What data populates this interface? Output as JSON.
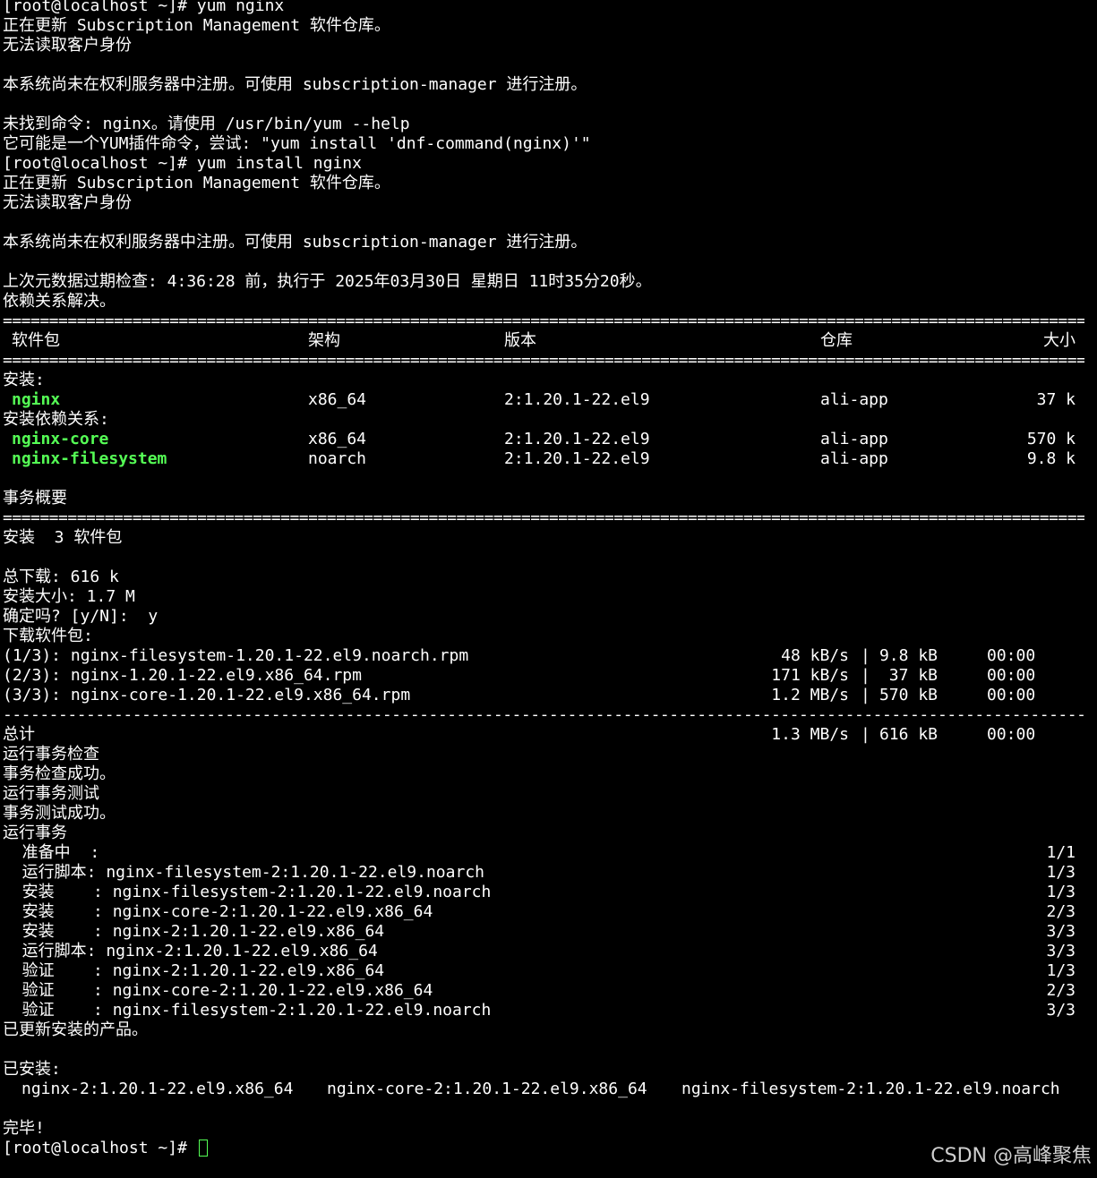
{
  "terminal": {
    "lines": [
      "[root@localhost ~]# yum nginx",
      "正在更新 Subscription Management 软件仓库。",
      "无法读取客户身份",
      "",
      "本系统尚未在权利服务器中注册。可使用 subscription-manager 进行注册。",
      "",
      "未找到命令: nginx。请使用 /usr/bin/yum --help",
      "它可能是一个YUM插件命令，尝试: \"yum install 'dnf-command(nginx)'\"",
      "[root@localhost ~]# yum install nginx",
      "正在更新 Subscription Management 软件仓库。",
      "无法读取客户身份",
      "",
      "本系统尚未在权利服务器中注册。可使用 subscription-manager 进行注册。",
      "",
      "上次元数据过期检查: 4:36:28 前，执行于 2025年03月30日 星期日 11时35分20秒。",
      "依赖关系解决。"
    ],
    "rule_double": "=====================================================================================================================================================",
    "rule_single": "-----------------------------------------------------------------------------------------------------------------------------------------------------",
    "table_headers": {
      "package": "软件包",
      "arch": "架构",
      "version": "版本",
      "repo": "仓库",
      "size": "大小"
    },
    "install_section": "安装:",
    "dep_section": "安装依赖关系:",
    "packages": [
      {
        "name": "nginx",
        "arch": "x86_64",
        "version": "2:1.20.1-22.el9",
        "repo": "ali-app",
        "size": "37 k"
      },
      {
        "name": "nginx-core",
        "arch": "x86_64",
        "version": "2:1.20.1-22.el9",
        "repo": "ali-app",
        "size": "570 k"
      },
      {
        "name": "nginx-filesystem",
        "arch": "noarch",
        "version": "2:1.20.1-22.el9",
        "repo": "ali-app",
        "size": "9.8 k"
      }
    ],
    "summary_title": "事务概要",
    "summary_line": "安装  3 软件包",
    "total_download": "总下载: 616 k",
    "install_size": "安装大小: 1.7 M",
    "confirm": "确定吗? [y/N]:  y",
    "downloading": "下载软件包:",
    "downloads": [
      {
        "label": "(1/3): nginx-filesystem-1.20.1-22.el9.noarch.rpm",
        "speed": "48 kB/s",
        "size": "9.8 kB",
        "time": "00:00"
      },
      {
        "label": "(2/3): nginx-1.20.1-22.el9.x86_64.rpm",
        "speed": "171 kB/s",
        "size": " 37 kB",
        "time": "00:00"
      },
      {
        "label": "(3/3): nginx-core-1.20.1-22.el9.x86_64.rpm",
        "speed": "1.2 MB/s",
        "size": "570 kB",
        "time": "00:00"
      }
    ],
    "total": {
      "label": "总计",
      "speed": "1.3 MB/s",
      "size": "616 kB",
      "time": "00:00"
    },
    "transaction_lines": [
      "运行事务检查",
      "事务检查成功。",
      "运行事务测试",
      "事务测试成功。",
      "运行事务"
    ],
    "steps": [
      {
        "text": "  准备中  :",
        "count": "1/1"
      },
      {
        "text": "  运行脚本: nginx-filesystem-2:1.20.1-22.el9.noarch",
        "count": "1/3"
      },
      {
        "text": "  安装    : nginx-filesystem-2:1.20.1-22.el9.noarch",
        "count": "1/3"
      },
      {
        "text": "  安装    : nginx-core-2:1.20.1-22.el9.x86_64",
        "count": "2/3"
      },
      {
        "text": "  安装    : nginx-2:1.20.1-22.el9.x86_64",
        "count": "3/3"
      },
      {
        "text": "  运行脚本: nginx-2:1.20.1-22.el9.x86_64",
        "count": "3/3"
      },
      {
        "text": "  验证    : nginx-2:1.20.1-22.el9.x86_64",
        "count": "1/3"
      },
      {
        "text": "  验证    : nginx-core-2:1.20.1-22.el9.x86_64",
        "count": "2/3"
      },
      {
        "text": "  验证    : nginx-filesystem-2:1.20.1-22.el9.noarch",
        "count": "3/3"
      }
    ],
    "updated": "已更新安装的产品。",
    "installed_title": "已安装:",
    "installed_list": [
      "nginx-2:1.20.1-22.el9.x86_64",
      "nginx-core-2:1.20.1-22.el9.x86_64",
      "nginx-filesystem-2:1.20.1-22.el9.noarch"
    ],
    "done": "完毕!",
    "prompt": "[root@localhost ~]# "
  },
  "watermark": "CSDN @高峰聚焦",
  "colors": {
    "background": "#000000",
    "text": "#ffffff",
    "highlight": "#55ff55"
  }
}
